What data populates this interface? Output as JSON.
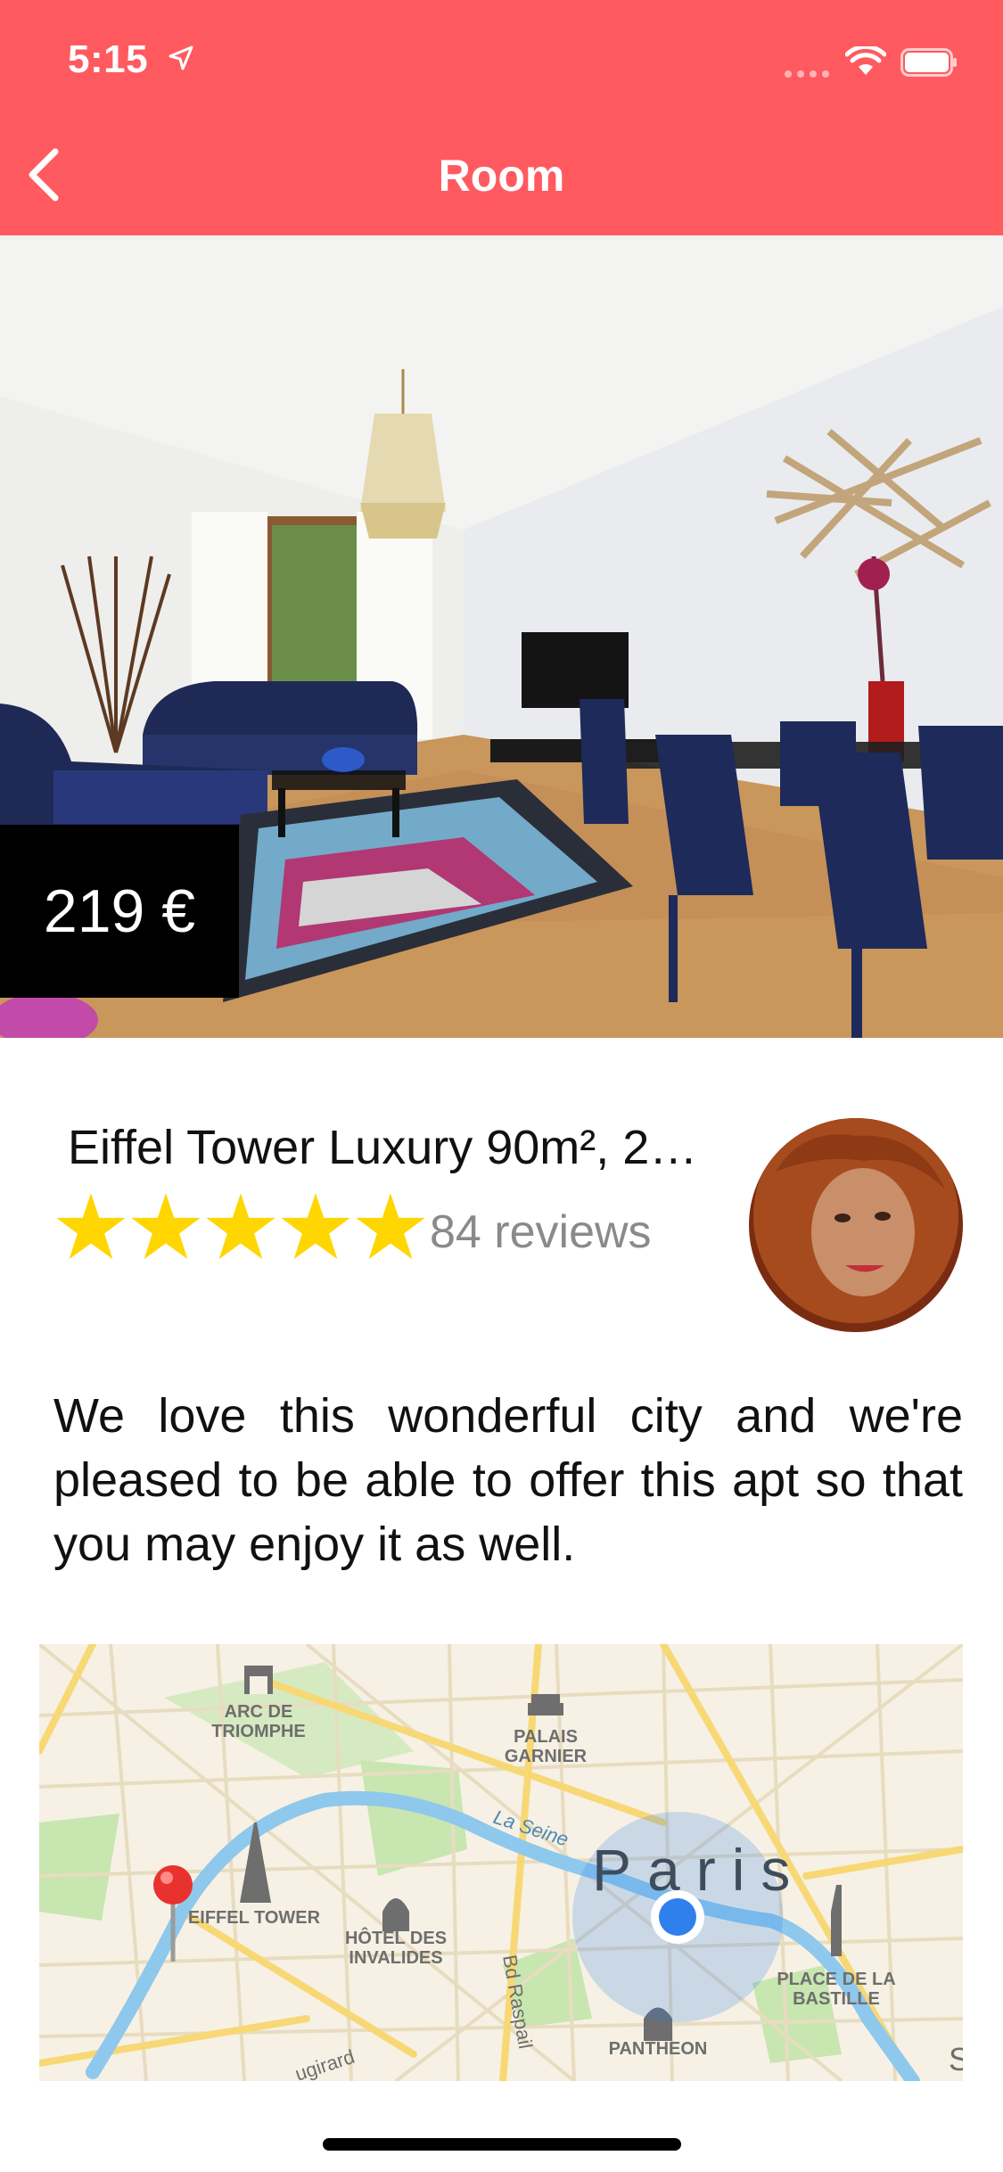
{
  "status_bar": {
    "time": "5:15"
  },
  "nav": {
    "title": "Room",
    "back_icon": "chevron-left-icon"
  },
  "listing": {
    "price": "219 €",
    "title": "Eiffel Tower Luxury 90m², 2…",
    "rating_stars": 5,
    "reviews": "84 reviews",
    "description": "We love this wonderful city and we're pleased to be able to offer this apt so that you may enjoy it as well."
  },
  "map": {
    "city": "Paris",
    "street_seine": "La Seine",
    "street_raspail": "Bd Raspail",
    "street_vaugirard": "ugirard",
    "poi_arc_1": "ARC DE",
    "poi_arc_2": "TRIOMPHE",
    "poi_garnier_1": "PALAIS",
    "poi_garnier_2": "GARNIER",
    "poi_eiffel": "EIFFEL TOWER",
    "poi_invalides_1": "HÔTEL DES",
    "poi_invalides_2": "INVALIDES",
    "poi_bastille_1": "PLACE DE LA",
    "poi_bastille_2": "BASTILLE",
    "poi_pantheon": "PANTHEON",
    "edge_letter": "S"
  },
  "colors": {
    "header": "#FF5A5F",
    "star": "#FFD600",
    "price_bg": "#000000",
    "map_land": "#F6F1E4",
    "map_water": "#8EC8EC",
    "map_park": "#C8E6B0",
    "location_dot": "#2F80ED"
  }
}
